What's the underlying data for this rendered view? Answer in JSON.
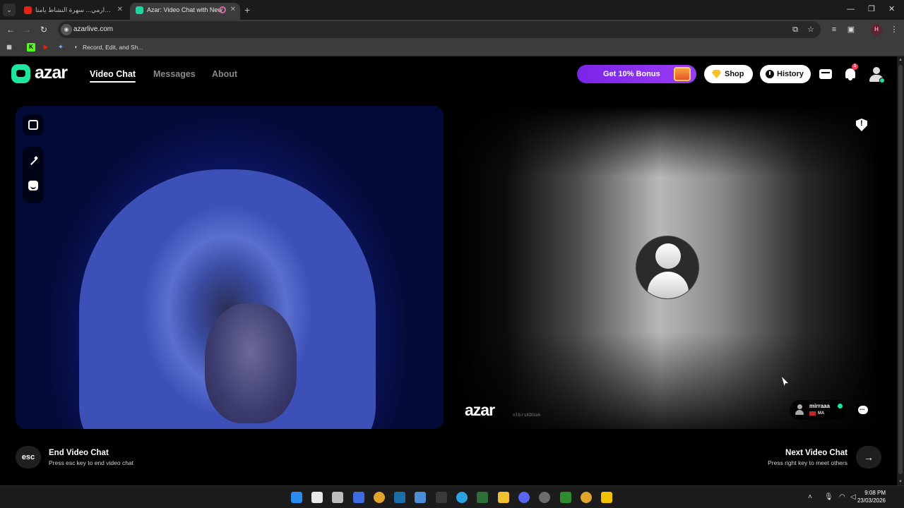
{
  "browser": {
    "tabs": [
      {
        "title": "وااااالجدارمي... سهرة النشاط يامتا",
        "active": false
      },
      {
        "title": "Azar: Video Chat with New",
        "active": true
      }
    ],
    "url": "azarlive.com",
    "bookmark_label": "Record, Edit, and Sh...",
    "profile_initial": "H"
  },
  "header": {
    "logo_text": "azar",
    "nav": [
      {
        "label": "Video Chat",
        "active": true
      },
      {
        "label": "Messages",
        "active": false
      },
      {
        "label": "About",
        "active": false
      }
    ],
    "bonus_label": "Get 10% Bonus",
    "shop_label": "Shop",
    "history_label": "History",
    "notification_count": "1",
    "accent_color": "#1ee5a0",
    "bonus_color": "#8a2cf0"
  },
  "remote": {
    "watermark": "azar",
    "watermark_id": "nlbrsKDUa6",
    "peer_name": "mirraaa",
    "peer_country": "MA"
  },
  "controls": {
    "esc_key": "esc",
    "end_title": "End Video Chat",
    "end_hint": "Press esc key to end video chat",
    "next_title": "Next Video Chat",
    "next_hint": "Press right key to meet others",
    "next_arrow": "→"
  },
  "taskbar": {
    "time": "9:08 PM",
    "date": "23/03/2026"
  }
}
